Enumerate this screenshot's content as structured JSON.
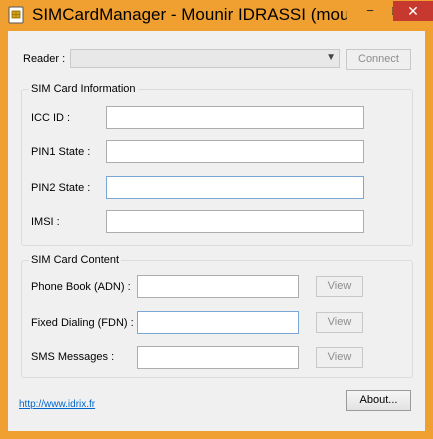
{
  "window": {
    "title": "SIMCardManager - Mounir IDRASSI (mouni",
    "minimize_glyph": "−",
    "maximize_glyph": "□",
    "close_glyph": "✕"
  },
  "reader": {
    "label": "Reader :",
    "selected_value": "",
    "connect_label": "Connect"
  },
  "sim_info": {
    "title": "SIM Card Information",
    "fields": [
      {
        "label": "ICC ID :",
        "value": ""
      },
      {
        "label": "PIN1 State :",
        "value": ""
      },
      {
        "label": "PIN2 State :",
        "value": ""
      },
      {
        "label": "IMSI :",
        "value": ""
      }
    ]
  },
  "sim_content": {
    "title": "SIM Card Content",
    "rows": [
      {
        "label": "Phone Book (ADN) :",
        "value": "",
        "button": "View"
      },
      {
        "label": "Fixed Dialing (FDN) :",
        "value": "",
        "button": "View"
      },
      {
        "label": "SMS Messages :",
        "value": "",
        "button": "View"
      }
    ]
  },
  "footer": {
    "link_text": "http://www.idrix.fr",
    "about_label": "About..."
  },
  "colors": {
    "title_bar": "#f0a030",
    "close_button": "#c7392f",
    "client_bg": "#f0f0f0",
    "link": "#0066cc"
  },
  "icons": [
    "app-icon",
    "dropdown-chevron-icon"
  ]
}
